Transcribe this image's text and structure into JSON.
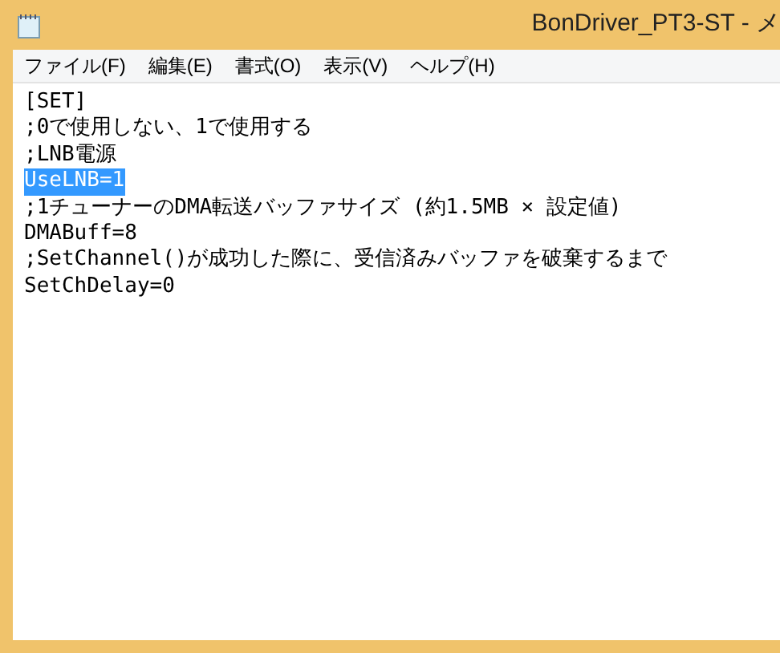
{
  "window": {
    "title": "BonDriver_PT3-ST - メ"
  },
  "menu": [
    {
      "label": "ファイル(F)"
    },
    {
      "label": "編集(E)"
    },
    {
      "label": "書式(O)"
    },
    {
      "label": "表示(V)"
    },
    {
      "label": "ヘルプ(H)"
    }
  ],
  "editor": {
    "lines": [
      {
        "text": "[SET]",
        "selected": false
      },
      {
        "text": ";0で使用しない、1で使用する",
        "selected": false
      },
      {
        "text": ";LNB電源",
        "selected": false
      },
      {
        "text": "UseLNB=1",
        "selected": true
      },
      {
        "text": ";1チューナーのDMA転送バッファサイズ (約1.5MB × 設定値)",
        "selected": false
      },
      {
        "text": "DMABuff=8",
        "selected": false
      },
      {
        "text": ";SetChannel()が成功した際に、受信済みバッファを破棄するまで",
        "selected": false
      },
      {
        "text": "SetChDelay=0",
        "selected": false
      }
    ]
  }
}
